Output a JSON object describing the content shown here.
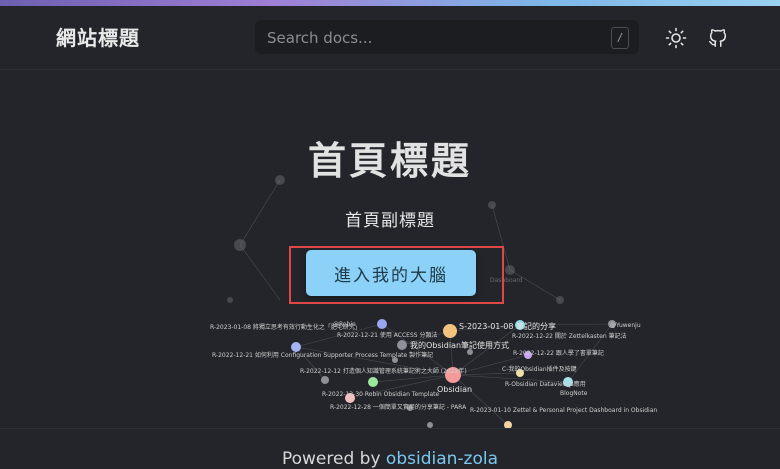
{
  "header": {
    "site_title": "網站標題",
    "search_placeholder": "Search docs...",
    "search_shortcut": "/",
    "theme_toggle_icon": "sun-icon",
    "github_icon": "github-icon"
  },
  "hero": {
    "title": "首頁標題",
    "subtitle": "首頁副標題",
    "cta_label": "進入我的大腦"
  },
  "graph": {
    "labels": [
      "R-2023-01-08 將獨立思考有效行動生化之「肥宅研究」",
      "@Robin",
      "R-2022-12-21 使用 ACCESS 分類法",
      "S-2023-01-08 筆記的分享",
      "R-2022-12-22 關於 Zettelkasten 筆記法",
      "@Yuwenju",
      "R-2022-12-21 如何利用 Configuration Supporter Process Template 製作筆記",
      "我的Obsidian筆記使用方式",
      "R-2022-12-22 跟人學了書單筆記",
      "R-2022-12-12 打造個人知識管理系統筆記術之大師 (2022年)",
      "Obsidian",
      "C-我的Obsidian插件及按鍵",
      "R-Obsidian Dataview.js應用",
      "R-2022-12-30 Robin Obsidian Template",
      "BlogNote",
      "R-2022-12-28 一個簡單又實用的分享筆記 - PARA",
      "R-2023-01-10 Zettel & Personal Project Dashboard in Obsidian",
      "Dashboard"
    ]
  },
  "footer": {
    "powered_prefix": "Powered by",
    "powered_link": "obsidian-zola"
  },
  "colors": {
    "background": "#23252a",
    "accent_gradient_start": "#6c5fb0",
    "accent_gradient_end": "#9ad0f0",
    "cta_background": "#8cd1f7",
    "highlight_border": "#e04848",
    "link": "#7cc7f0"
  }
}
